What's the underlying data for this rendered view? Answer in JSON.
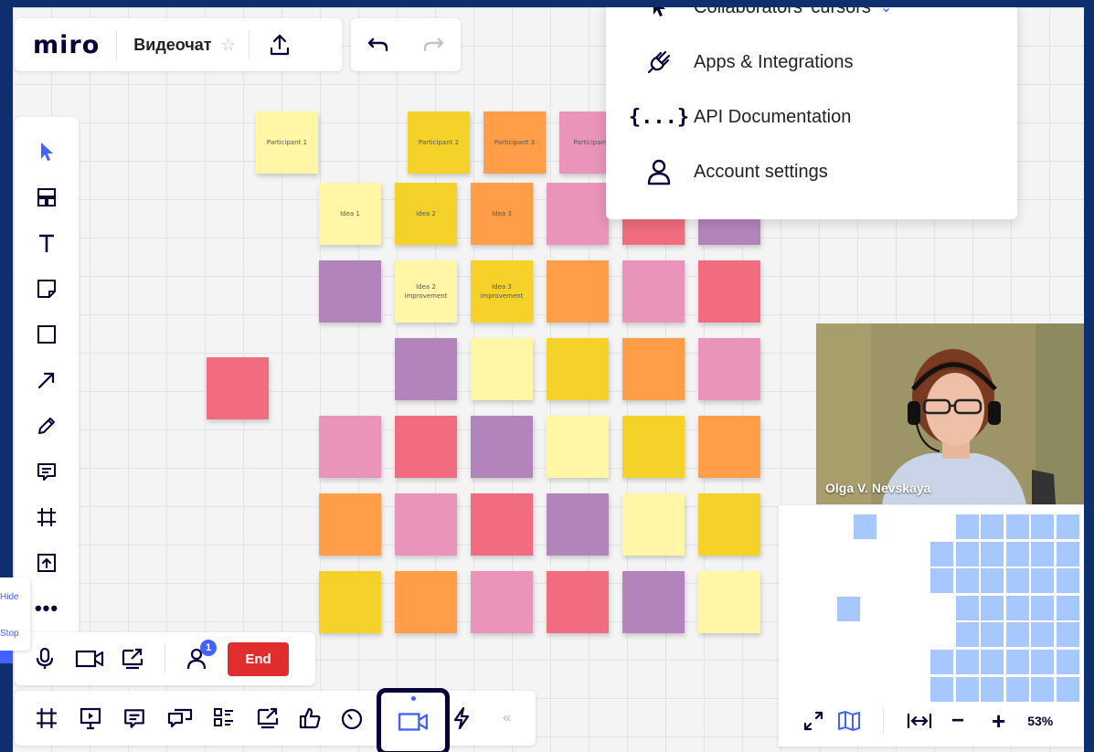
{
  "app": {
    "logo": "miro",
    "board_title": "Видеочат"
  },
  "colors": {
    "yellow_light": "#fff6a6",
    "yellow": "#f5d229",
    "orange": "#ff9d48",
    "pink": "#ea94bb",
    "red": "#f16c7f",
    "purple": "#b384bb",
    "accent_blue": "#4262ff",
    "minimap_cell": "#a6c8ff",
    "end_red": "#e02d2d"
  },
  "stickies": {
    "participant1": "Participant 1",
    "participant2": "Participant 2",
    "participant3": "Participant 3",
    "participant4": "Participant",
    "idea1": "Idea 1",
    "idea2": "Idea 2",
    "idea3": "Idea 3",
    "idea2_improvement": "Idea 2 improvement",
    "idea3_improvement": "Idea 3 improvement"
  },
  "menu": {
    "items": [
      {
        "label": "Collaborators' cursors",
        "icon": "cursor-icon"
      },
      {
        "label": "Apps & Integrations",
        "icon": "plug-icon"
      },
      {
        "label": "API Documentation",
        "icon": "braces-icon"
      },
      {
        "label": "Account settings",
        "icon": "user-icon"
      }
    ]
  },
  "video": {
    "participant_name": "Olga V. Nevskaya"
  },
  "call": {
    "end_label": "End",
    "participants_badge": "1"
  },
  "side_tab": {
    "hide_label": "Hide",
    "stop_label": "Stop"
  },
  "zoom": {
    "level": "53%"
  }
}
